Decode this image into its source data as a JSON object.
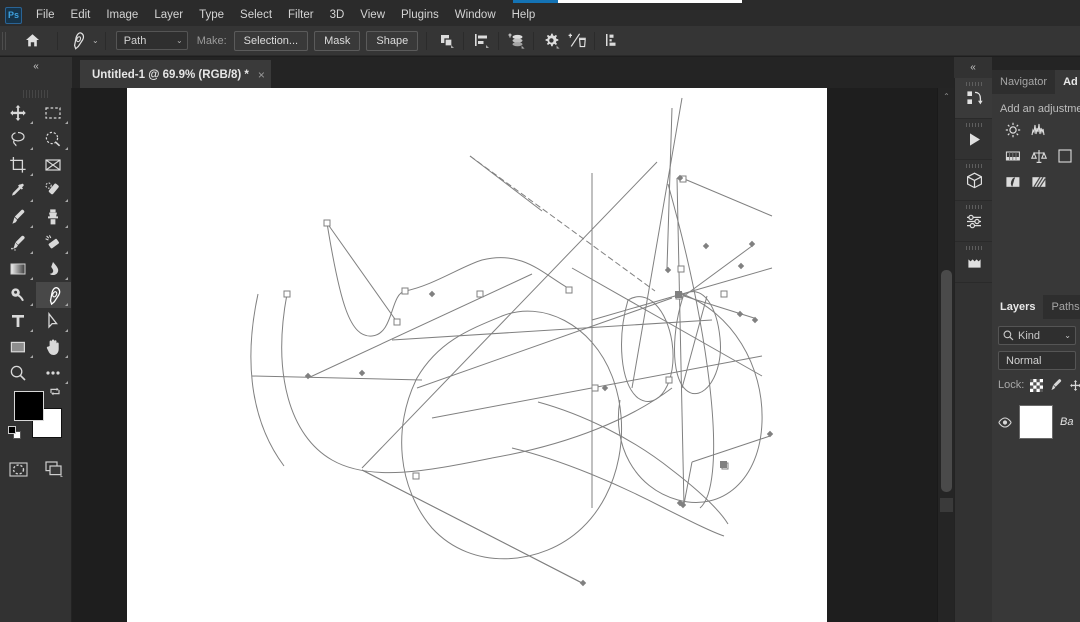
{
  "app": {
    "name": "Photoshop",
    "logo_text": "Ps"
  },
  "menubar": {
    "items": [
      {
        "label": "File"
      },
      {
        "label": "Edit"
      },
      {
        "label": "Image"
      },
      {
        "label": "Layer"
      },
      {
        "label": "Type"
      },
      {
        "label": "Select"
      },
      {
        "label": "Filter"
      },
      {
        "label": "3D"
      },
      {
        "label": "View"
      },
      {
        "label": "Plugins"
      },
      {
        "label": "Window"
      },
      {
        "label": "Help"
      }
    ]
  },
  "options_bar": {
    "home_icon": "home-icon",
    "tool_icon": "pen-tool-icon",
    "mode_select": {
      "value": "Path",
      "caret": "⌄"
    },
    "make_label": "Make:",
    "buttons": [
      {
        "label": "Selection..."
      },
      {
        "label": "Mask"
      },
      {
        "label": "Shape"
      }
    ],
    "icons": [
      {
        "name": "path-operations-icon"
      },
      {
        "name": "path-alignment-icon"
      },
      {
        "name": "path-arrangement-icon"
      },
      {
        "name": "path-settings-gear-icon"
      },
      {
        "name": "auto-add-delete-icon"
      },
      {
        "name": "align-edges-icon"
      }
    ]
  },
  "tab_bar": {
    "collapse_icon": "«",
    "document": {
      "title": "Untitled-1 @ 69.9% (RGB/8) *",
      "close_icon": "×"
    }
  },
  "toolbar": {
    "tools": [
      {
        "name": "move-tool",
        "row": 0,
        "col": 0
      },
      {
        "name": "rectangular-marquee-tool",
        "row": 0,
        "col": 1
      },
      {
        "name": "lasso-tool",
        "row": 1,
        "col": 0
      },
      {
        "name": "object-selection-tool",
        "row": 1,
        "col": 1
      },
      {
        "name": "crop-tool",
        "row": 2,
        "col": 0
      },
      {
        "name": "frame-tool",
        "row": 2,
        "col": 1
      },
      {
        "name": "eyedropper-tool",
        "row": 3,
        "col": 0
      },
      {
        "name": "spot-healing-brush-tool",
        "row": 3,
        "col": 1
      },
      {
        "name": "brush-tool",
        "row": 4,
        "col": 0
      },
      {
        "name": "clone-stamp-tool",
        "row": 4,
        "col": 1
      },
      {
        "name": "history-brush-tool",
        "row": 5,
        "col": 0
      },
      {
        "name": "eraser-tool",
        "row": 5,
        "col": 1
      },
      {
        "name": "gradient-tool",
        "row": 6,
        "col": 0
      },
      {
        "name": "blur-tool",
        "row": 6,
        "col": 1
      },
      {
        "name": "dodge-tool",
        "row": 7,
        "col": 0
      },
      {
        "name": "pen-tool",
        "row": 7,
        "col": 1,
        "active": true
      },
      {
        "name": "type-tool",
        "row": 8,
        "col": 0
      },
      {
        "name": "path-selection-tool",
        "row": 8,
        "col": 1
      },
      {
        "name": "rectangle-tool",
        "row": 9,
        "col": 0
      },
      {
        "name": "hand-tool",
        "row": 9,
        "col": 1
      },
      {
        "name": "zoom-tool",
        "row": 10,
        "col": 0
      },
      {
        "name": "edit-toolbar-tool",
        "row": 10,
        "col": 1
      }
    ],
    "colors": {
      "foreground": "#000000",
      "background": "#ffffff",
      "swap_icon": "swap-colors-icon",
      "default_icon": "default-colors-icon"
    },
    "modes": [
      {
        "name": "quick-mask-icon"
      },
      {
        "name": "screen-mode-icon"
      }
    ]
  },
  "canvas": {
    "background": "#1e1e1e",
    "paper": "#ffffff",
    "path_color": "#808080",
    "zoom": "69.9%",
    "color_mode": "RGB/8"
  },
  "scrollbar": {
    "arrow_up": "⌃"
  },
  "rail": {
    "collapse_icon": "«",
    "items": [
      {
        "name": "libraries-icon",
        "selected": true
      },
      {
        "name": "actions-play-icon"
      },
      {
        "name": "3d-cube-icon"
      },
      {
        "name": "adjustments-sliders-icon"
      },
      {
        "name": "patterns-icon"
      }
    ]
  },
  "panels": {
    "top": {
      "tabs": [
        {
          "label": "Navigator",
          "active": false
        },
        {
          "label": "Ad",
          "active": true
        }
      ],
      "adjustments_title": "Add an adjustme",
      "adjustment_icons": [
        {
          "name": "brightness-contrast-icon"
        },
        {
          "name": "levels-icon"
        },
        {
          "name": "curves-icon"
        },
        {
          "name": "exposure-icon"
        },
        {
          "name": "vibrance-icon"
        },
        {
          "name": "hue-saturation-icon"
        },
        {
          "name": "color-balance-icon"
        },
        {
          "name": "black-white-icon"
        }
      ]
    },
    "layers": {
      "tabs": [
        {
          "label": "Layers",
          "active": true
        },
        {
          "label": "Paths",
          "active": false
        }
      ],
      "filter": {
        "icon": "search-icon",
        "value": "Kind",
        "caret": "⌄"
      },
      "blend_mode": "Normal",
      "lock_label": "Lock:",
      "lock_icons": [
        {
          "name": "lock-transparent-pixels-icon"
        },
        {
          "name": "lock-image-pixels-icon"
        },
        {
          "name": "lock-position-icon"
        }
      ],
      "rows": [
        {
          "visibility_icon": "eye-icon",
          "thumbnail": "#ffffff",
          "name": "Ba"
        }
      ]
    }
  },
  "chart_data": null
}
